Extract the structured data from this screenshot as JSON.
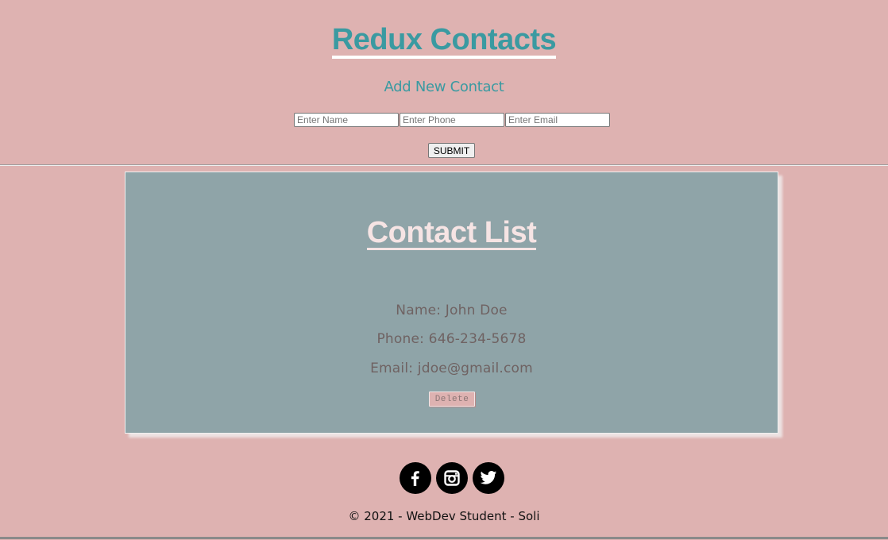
{
  "header": {
    "title": "Redux Contacts",
    "form_heading": "Add New Contact"
  },
  "form": {
    "name_placeholder": "Enter Name",
    "phone_placeholder": "Enter Phone",
    "email_placeholder": "Enter Email",
    "name_value": "",
    "phone_value": "",
    "email_value": "",
    "submit_label": "SUBMIT"
  },
  "contact_list": {
    "title": "Contact List",
    "contacts": [
      {
        "name_line": "Name: John Doe",
        "phone_line": "Phone: 646-234-5678",
        "email_line": "Email: jdoe@gmail.com",
        "delete_label": "Delete"
      }
    ]
  },
  "footer": {
    "social": [
      {
        "icon": "facebook-icon"
      },
      {
        "icon": "instagram-icon"
      },
      {
        "icon": "twitter-icon"
      }
    ],
    "copyright": "© 2021 - WebDev Student - Soli"
  },
  "colors": {
    "background": "#deb2b1",
    "accent": "#3a9aa1",
    "panel": "#8fa4a8",
    "panel_title": "#f6e4e4",
    "contact_text": "#6f6262"
  }
}
